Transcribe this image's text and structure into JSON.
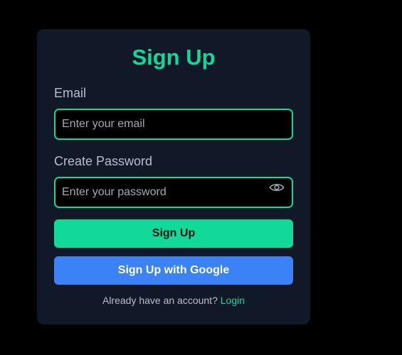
{
  "form": {
    "title": "Sign Up",
    "email_label": "Email",
    "email_placeholder": "Enter your email",
    "email_value": "",
    "password_label": "Create Password",
    "password_placeholder": "Enter your password",
    "password_value": "",
    "password_toggle_icon": "eye-icon",
    "signup_button_label": "Sign Up",
    "google_button_label": "Sign Up with Google",
    "footer_text": "Already have an account?",
    "login_link_label": "Login"
  },
  "colors": {
    "page_background": "#000000",
    "card_background": "#111827",
    "accent": "#10d99a",
    "google_blue": "#3b82f6",
    "muted_text": "#b7bfcc"
  }
}
